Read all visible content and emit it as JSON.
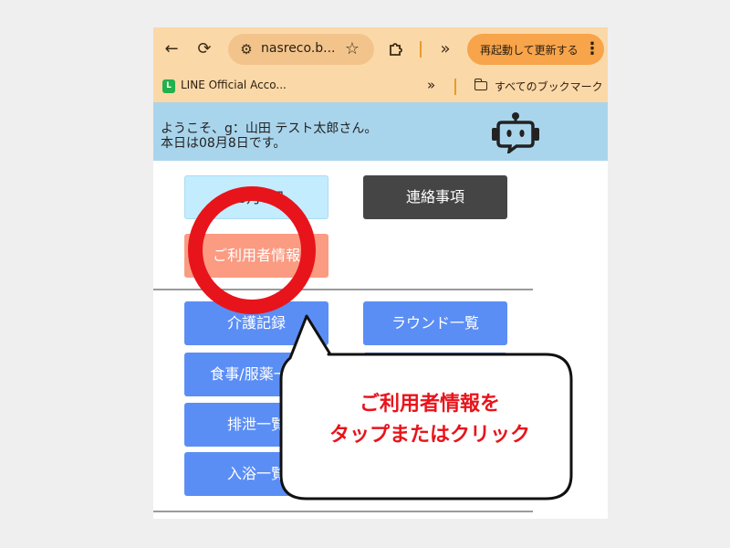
{
  "browser": {
    "url": "nasreco.b...",
    "update_label": "再起動して更新する",
    "bookmark_label": "LINE Official Acco...",
    "bookmarks_folder_label": "すべてのブックマーク",
    "line_icon_letter": "L"
  },
  "header": {
    "welcome_line1": "ようこそ、g：山田 テスト太郎さん。",
    "welcome_line2": "本日は08月8日です。"
  },
  "menu": {
    "date_label": "08月8日",
    "notice_label": "連絡事項",
    "user_info_label": "ご利用者情報",
    "care_record_label": "介護記録",
    "round_list_label": "ラウンド一覧",
    "meal_med_label": "食事/服薬一覧",
    "excretion_label": "排泄一覧",
    "bath_label": "入浴一覧"
  },
  "annotation": {
    "line1": "ご利用者情報を",
    "line2": "タップまたはクリック",
    "accent_color": "#e8141b"
  }
}
